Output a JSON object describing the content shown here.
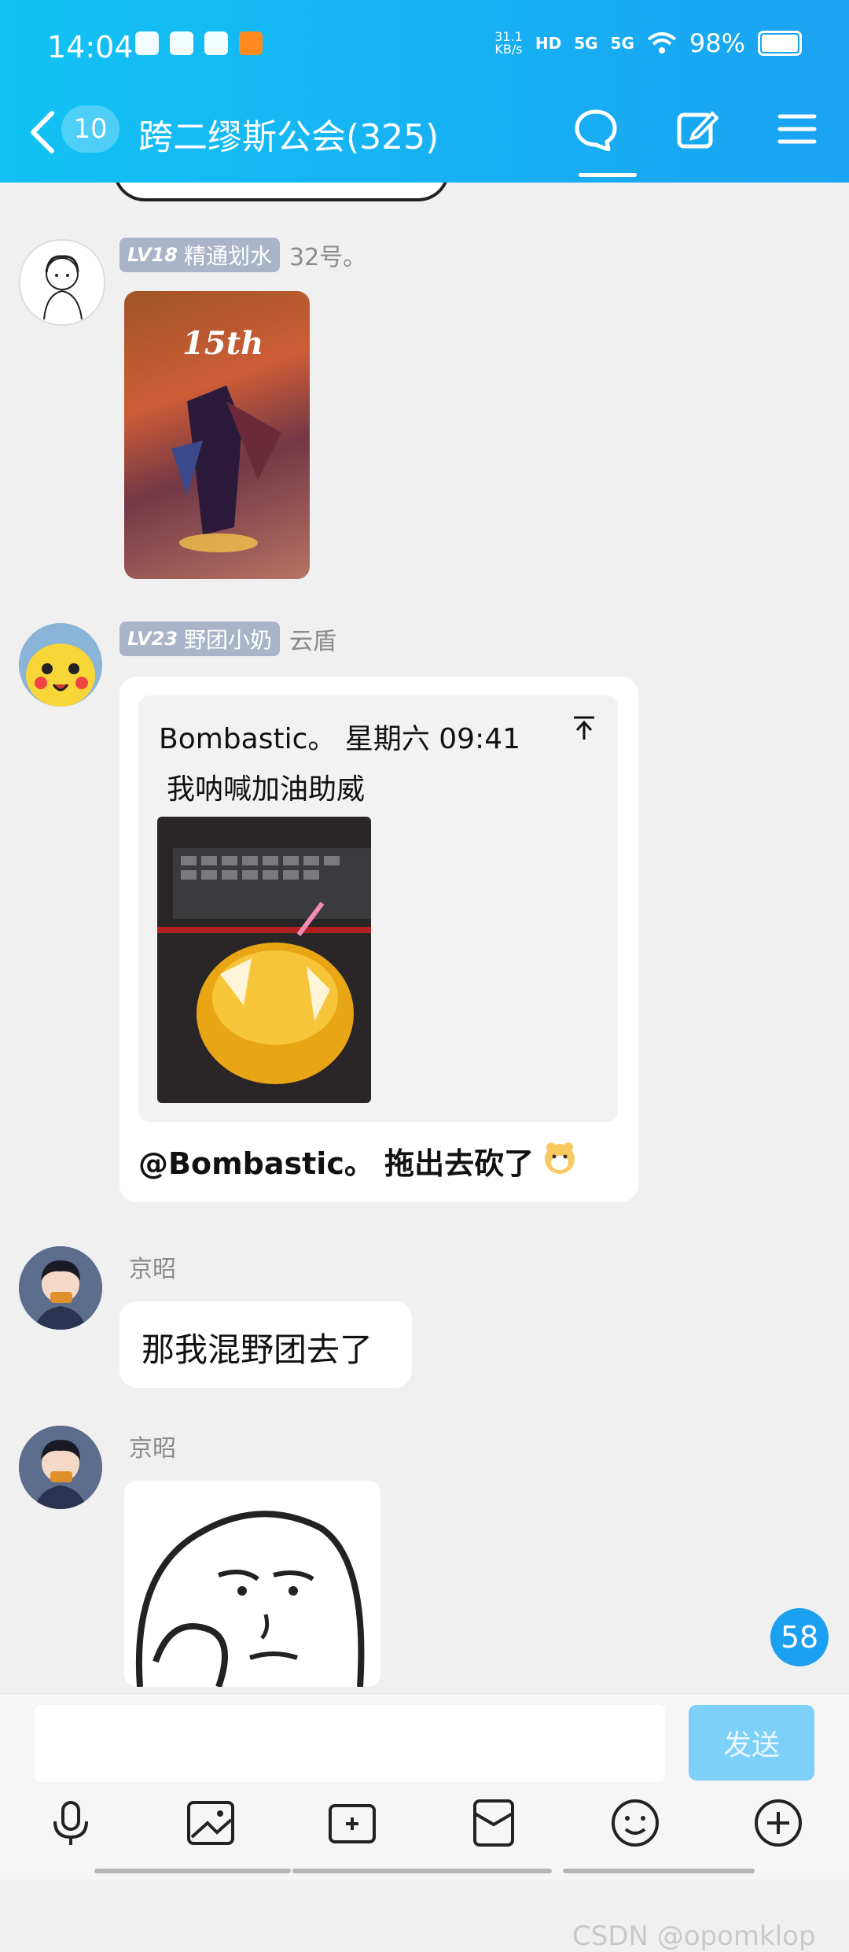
{
  "status_bar": {
    "time": "14:04",
    "net_speed_value": "31.1",
    "net_speed_unit": "KB/s",
    "hd_label": "HD",
    "sim1_label": "5G",
    "sim2_label": "5G",
    "battery": "98%"
  },
  "nav": {
    "unread_count": "10",
    "group_title": "跨二缪斯公会(325)"
  },
  "messages": [
    {
      "level": "LV18",
      "title": "精通划水",
      "sender": "32号。",
      "type": "image"
    },
    {
      "level": "LV23",
      "title": "野团小奶",
      "sender": "云盾",
      "type": "quote_reply",
      "quote_author": "Bombastic。 星期六 09:41",
      "quote_text": "我呐喊加油助威",
      "reply_text": "@Bombastic。 拖出去砍了"
    },
    {
      "sender": "京昭",
      "type": "text",
      "text": "那我混野团去了"
    },
    {
      "sender": "京昭",
      "type": "sticker"
    }
  ],
  "unread_floating": "58",
  "input": {
    "placeholder": "",
    "send_label": "发送"
  },
  "watermark": "CSDN @opomklop",
  "colors": {
    "header_start": "#12c2f4",
    "header_end": "#1aa3f2",
    "send_disabled": "#7dd1f9",
    "badge": "#aab4c8",
    "unread_bubble": "#1b9ff0"
  }
}
